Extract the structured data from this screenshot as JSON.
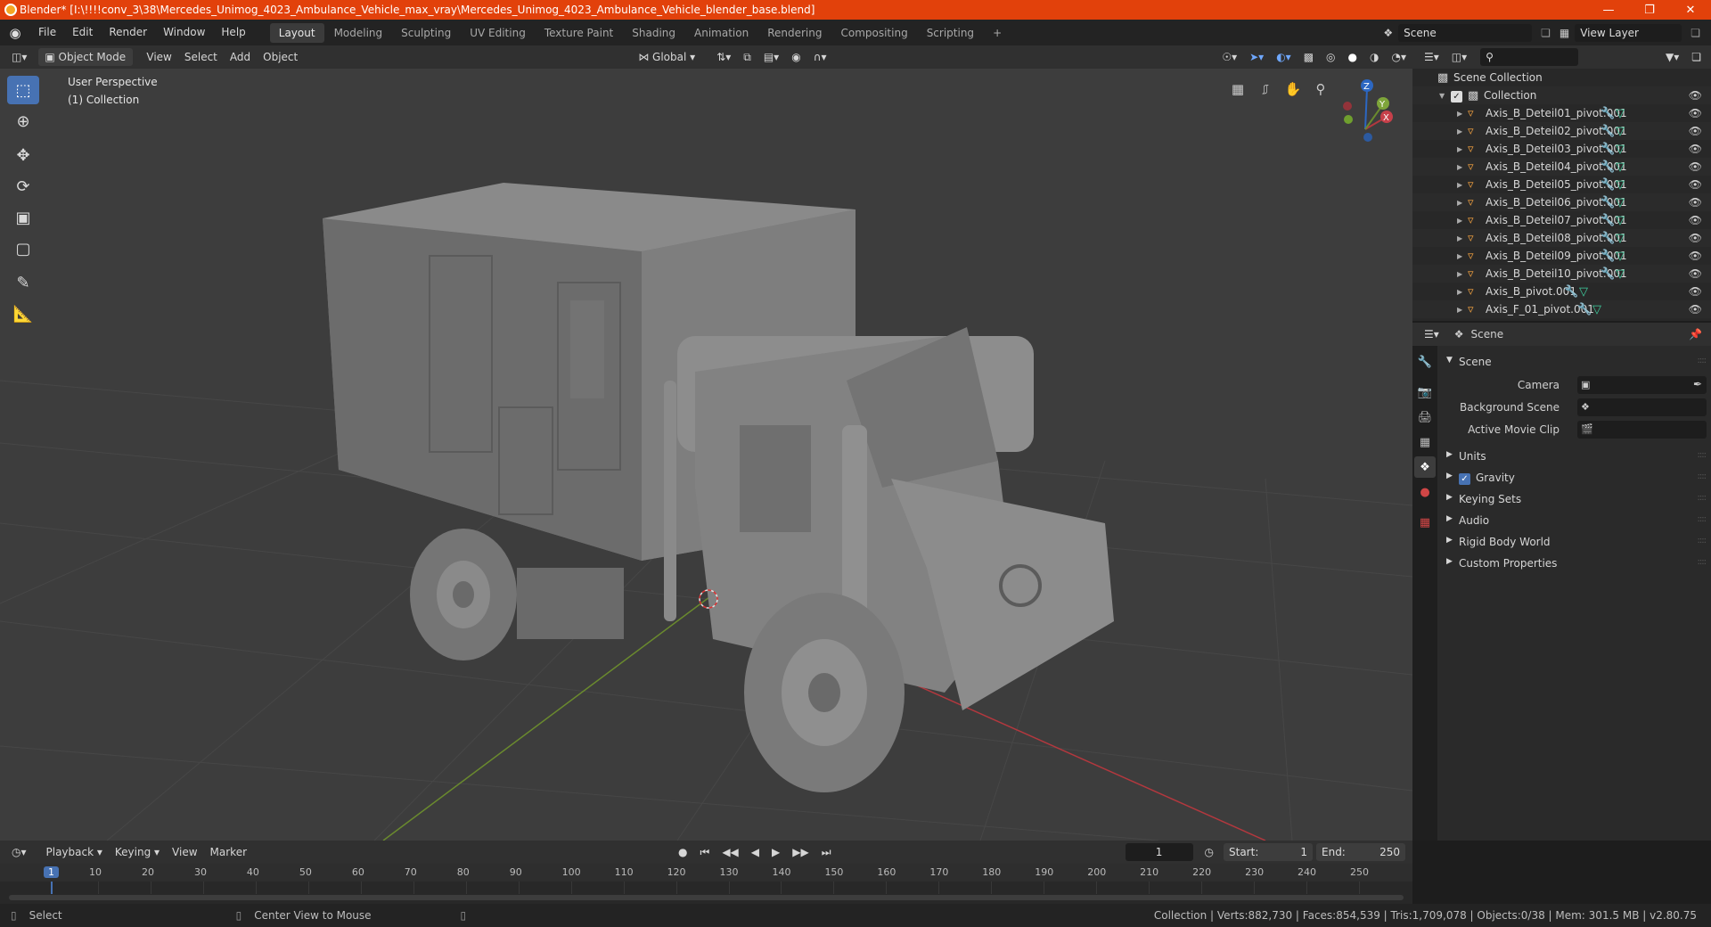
{
  "window": {
    "title": "Blender* [I:\\!!!!conv_3\\38\\Mercedes_Unimog_4023_Ambulance_Vehicle_max_vray\\Mercedes_Unimog_4023_Ambulance_Vehicle_blender_base.blend]",
    "min_icon": "minimize-icon",
    "max_icon": "maximize-icon",
    "close_icon": "close-icon"
  },
  "menu": {
    "items": [
      "File",
      "Edit",
      "Render",
      "Window",
      "Help"
    ],
    "workspaces": [
      "Layout",
      "Modeling",
      "Sculpting",
      "UV Editing",
      "Texture Paint",
      "Shading",
      "Animation",
      "Rendering",
      "Compositing",
      "Scripting"
    ],
    "active_workspace": "Layout",
    "add_tab": "+",
    "scene": "Scene",
    "view_layer": "View Layer"
  },
  "viewport": {
    "mode": "Object Mode",
    "menus": [
      "View",
      "Select",
      "Add",
      "Object"
    ],
    "orientation": "Global",
    "perspective_label": "User Perspective",
    "collection_label": "(1) Collection",
    "gizmo": {
      "x": "X",
      "y": "Y",
      "z": "Z"
    },
    "colors": {
      "x_axis": "#b3383e",
      "y_axis": "#6a8a2e",
      "z_axis": "#2c67c2"
    }
  },
  "outliner": {
    "root": "Scene Collection",
    "collection": "Collection",
    "items": [
      "Axis_B_Deteil01_pivot.001",
      "Axis_B_Deteil02_pivot.001",
      "Axis_B_Deteil03_pivot.001",
      "Axis_B_Deteil04_pivot.001",
      "Axis_B_Deteil05_pivot.001",
      "Axis_B_Deteil06_pivot.001",
      "Axis_B_Deteil07_pivot.001",
      "Axis_B_Deteil08_pivot.001",
      "Axis_B_Deteil09_pivot.001",
      "Axis_B_Deteil10_pivot.001",
      "Axis_B_pivot.001",
      "Axis_F_01_pivot.001"
    ]
  },
  "properties": {
    "context": "Scene",
    "panel": "Scene",
    "camera_label": "Camera",
    "background_scene_label": "Background Scene",
    "active_movie_clip_label": "Active Movie Clip",
    "sections": [
      "Units",
      "Gravity",
      "Keying Sets",
      "Audio",
      "Rigid Body World",
      "Custom Properties"
    ],
    "gravity_checked": true
  },
  "timeline": {
    "menus": [
      "Playback",
      "Keying",
      "View",
      "Marker"
    ],
    "current_frame": "1",
    "start_label": "Start:",
    "start": "1",
    "end_label": "End:",
    "end": "250",
    "ruler": [
      "1",
      "10",
      "20",
      "30",
      "40",
      "50",
      "60",
      "70",
      "80",
      "90",
      "100",
      "110",
      "120",
      "130",
      "140",
      "150",
      "160",
      "170",
      "180",
      "190",
      "200",
      "210",
      "220",
      "230",
      "240",
      "250"
    ]
  },
  "status": {
    "select": "Select",
    "center_view": "Center View to Mouse",
    "stats": "Collection | Verts:882,730 | Faces:854,539 | Tris:1,709,078 | Objects:0/38 | Mem: 301.5 MB | v2.80.75"
  }
}
